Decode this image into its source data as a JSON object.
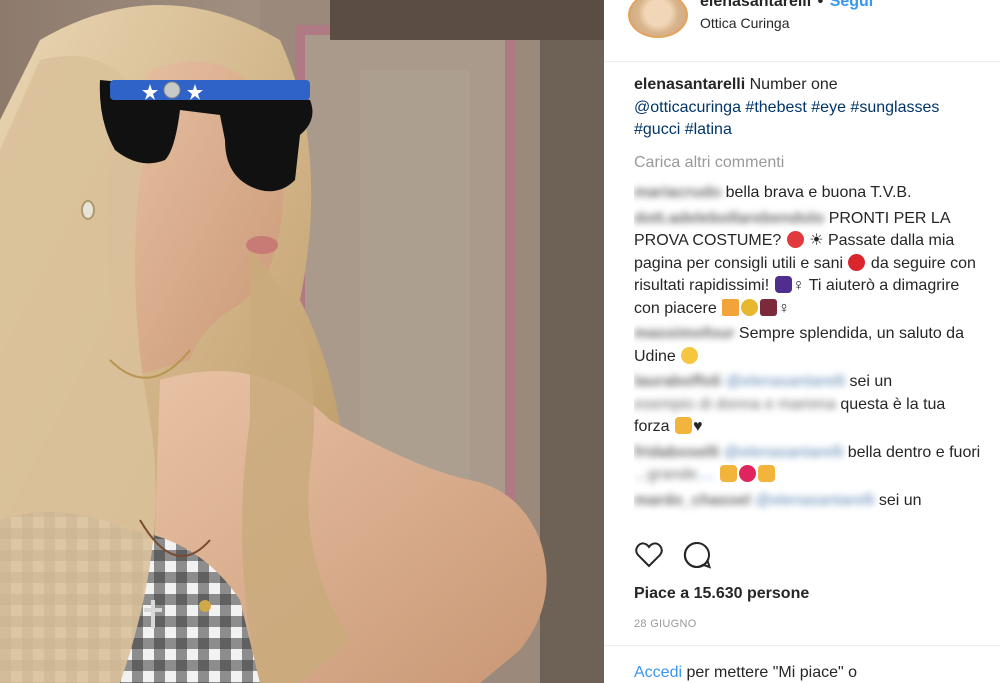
{
  "header": {
    "username": "elenasantarelli",
    "separator": "•",
    "follow_label": "Segui",
    "location": "Ottica Curinga"
  },
  "caption": {
    "username": "elenasantarelli",
    "text": "Number one",
    "tags": [
      "@otticacuringa",
      "#thebest",
      "#eye",
      "#sunglasses",
      "#gucci",
      "#latina"
    ]
  },
  "load_more_label": "Carica altri commenti",
  "comments": [
    {
      "username": "mariacrudo",
      "segments": [
        "bella brava e buona T.V.B."
      ]
    },
    {
      "username": "dott.adelebollarebendolo",
      "segments": [
        "PRONTI PER LA PROVA COSTUME?",
        " ☀ Passate dalla mia pagina per consigli utili e sani",
        " da seguire con risultati rapidissimi!",
        "♀ Ti aiuterò a dimagrire con piacere",
        "♀"
      ]
    },
    {
      "username": "massimofour",
      "segments": [
        "Sempre splendida, un saluto da Udine"
      ]
    },
    {
      "username": "lauraboffoli",
      "mention": "@elenasantarelli",
      "segments": [
        "sei un",
        "esempio di donna e mamma",
        "questa è la tua forza"
      ]
    },
    {
      "username": "fridaboselli",
      "mention": "@elenasantarelli",
      "segments": [
        "bella dentro e fuori",
        "...grande",
        "...."
      ]
    },
    {
      "username": "mardo_chassel",
      "mention": "@elenasantarelli",
      "segments": [
        "sei un"
      ]
    }
  ],
  "actions": {
    "like_icon": "heart-icon",
    "comment_icon": "comment-bubble-icon"
  },
  "likes": {
    "prefix": "Piace a",
    "count": "15.630",
    "suffix": "persone"
  },
  "date": "28 GIUGNO",
  "login": {
    "link": "Accedi",
    "text": "per mettere \"Mi piace\" o"
  },
  "colors": {
    "link": "#003569",
    "accent": "#3897f0",
    "muted": "#999999",
    "text": "#262626"
  }
}
